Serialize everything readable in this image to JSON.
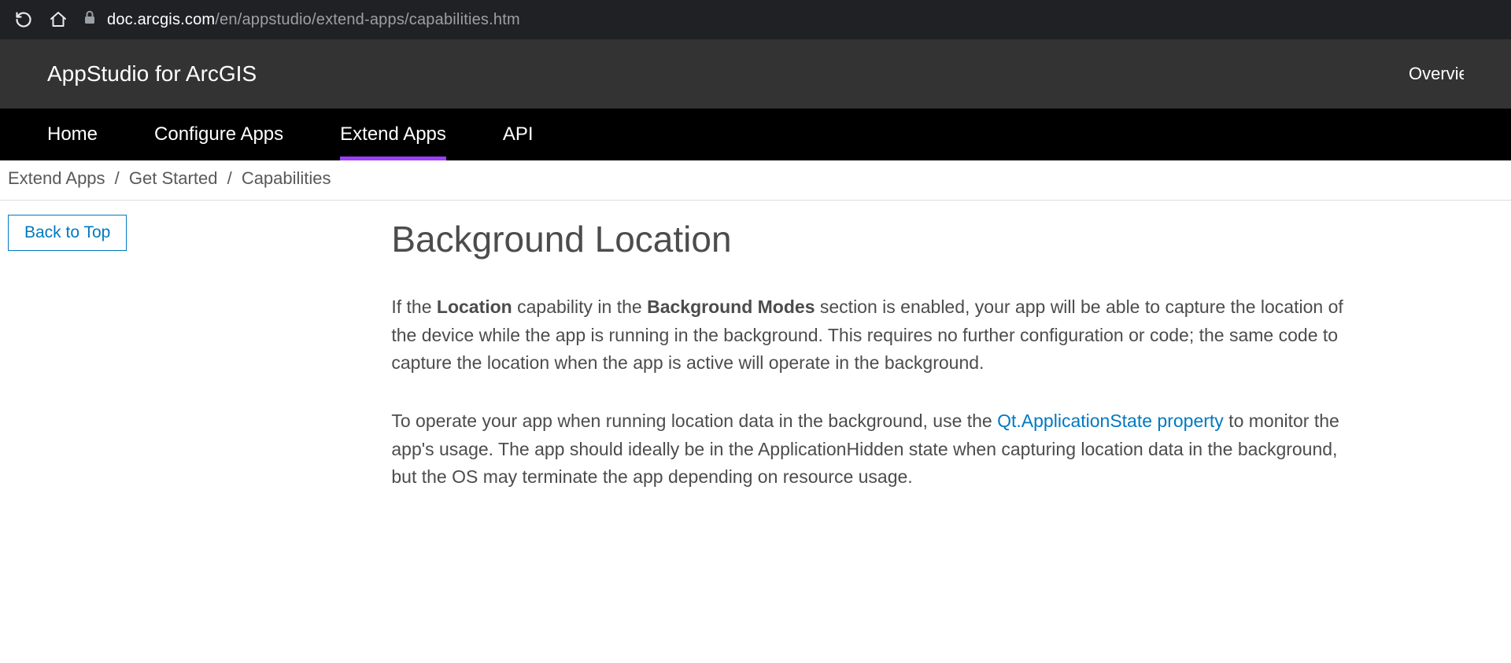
{
  "browser": {
    "url_domain": "doc.arcgis.com",
    "url_path": "/en/appstudio/extend-apps/capabilities.htm"
  },
  "header": {
    "title": "AppStudio for ArcGIS",
    "right_link": "Overview"
  },
  "nav": {
    "items": [
      {
        "label": "Home",
        "active": false
      },
      {
        "label": "Configure Apps",
        "active": false
      },
      {
        "label": "Extend Apps",
        "active": true
      },
      {
        "label": "API",
        "active": false
      }
    ]
  },
  "breadcrumb": {
    "items": [
      "Extend Apps",
      "Get Started",
      "Capabilities"
    ]
  },
  "sidebar": {
    "back_to_top": "Back to Top"
  },
  "content": {
    "heading": "Background Location",
    "p1_pre": "If the ",
    "p1_b1": "Location",
    "p1_mid1": " capability in the ",
    "p1_b2": "Background Modes",
    "p1_post": " section is enabled, your app will be able to capture the location of the device while the app is running in the background. This requires no further configuration or code; the same code to capture the location when the app is active will operate in the background.",
    "p2_pre": "To operate your app when running location data in the background, use the ",
    "p2_link": "Qt.ApplicationState property",
    "p2_post": " to monitor the app's usage. The app should ideally be in the ApplicationHidden state when capturing location data in the background, but the OS may terminate the app depending on resource usage."
  }
}
